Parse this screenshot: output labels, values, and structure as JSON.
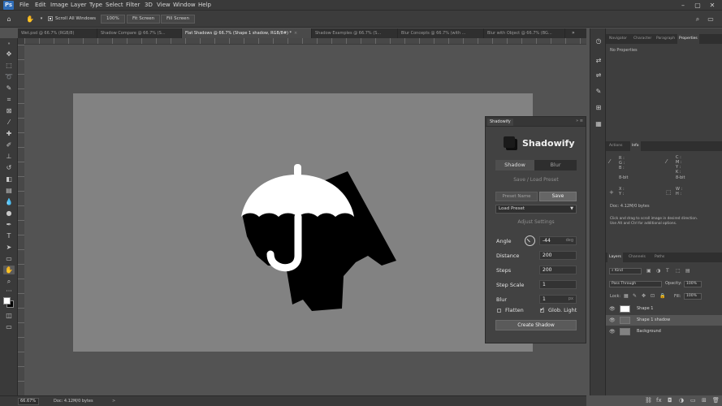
{
  "app": {
    "logo": "Ps"
  },
  "menu": [
    "File",
    "Edit",
    "Image",
    "Layer",
    "Type",
    "Select",
    "Filter",
    "3D",
    "View",
    "Window",
    "Help"
  ],
  "options_bar": {
    "scroll_all": "Scroll All Windows",
    "zoom_100": "100%",
    "fit_screen": "Fit Screen",
    "fill_screen": "Fill Screen"
  },
  "tabs": [
    {
      "label": "Wet.psd @ 66.7% (RGB/8)",
      "active": false
    },
    {
      "label": "Shadow Compare @ 66.7% (S...",
      "active": false
    },
    {
      "label": "Flat Shadows @ 66.7% (Shape 1 shadow, RGB/8#) *",
      "active": true
    },
    {
      "label": "Shadow Examples @ 66.7% (S...",
      "active": false
    },
    {
      "label": "Blur Concepts @ 66.7% (with ...",
      "active": false
    },
    {
      "label": "Blur with Object @ 66.7% (BG...",
      "active": false
    }
  ],
  "shadowify": {
    "panel_tab": "Shadowify",
    "panel_ctrls": "»  ≡",
    "title": "Shadowify",
    "tab_shadow": "Shadow",
    "tab_blur": "Blur",
    "save_load_header": "Save / Load Preset",
    "preset_name_placeholder": "Preset Name",
    "save_label": "Save",
    "load_preset": "Load Preset",
    "adjust_header": "Adjust Settings",
    "angle_label": "Angle",
    "angle_value": "-44",
    "angle_unit": "deg",
    "distance_label": "Distance",
    "distance_value": "200",
    "steps_label": "Steps",
    "steps_value": "200",
    "step_scale_label": "Step Scale",
    "step_scale_value": "1",
    "blur_label": "Blur",
    "blur_value": "1",
    "blur_unit": "px",
    "flatten_label": "Flatten",
    "flatten_checked": false,
    "global_light_label": "Glob. Light",
    "global_light_checked": true,
    "create_label": "Create Shadow"
  },
  "properties_panel": {
    "tabs": [
      "Navigator",
      "Character",
      "Paragraph",
      "Properties"
    ],
    "active_tab": "Properties",
    "content": "No Properties"
  },
  "info_panel": {
    "tabs": [
      "Actions",
      "Info"
    ],
    "active_tab": "Info",
    "r": "R :",
    "g": "G :",
    "b": "B :",
    "bit_left": "8-bit",
    "c": "C :",
    "m": "M :",
    "y": "Y :",
    "k": "K :",
    "bit_right": "8-bit",
    "x": "X :",
    "y_coord": "Y :",
    "w": "W :",
    "h": "H :",
    "doc": "Doc: 4.12M/0 bytes",
    "hint1": "Click and drag to scroll image in desired direction.",
    "hint2": "Use Alt and Ctrl for additional options."
  },
  "layers_panel": {
    "tabs": [
      "Layers",
      "Channels",
      "Paths"
    ],
    "active_tab": "Layers",
    "kind": "Kind",
    "blend_mode": "Pass Through",
    "opacity_label": "Opacity:",
    "opacity_value": "100%",
    "lock_label": "Lock:",
    "fill_label": "Fill:",
    "fill_value": "100%",
    "layers": [
      {
        "name": "Shape 1",
        "selected": false,
        "visible": true
      },
      {
        "name": "Shape 1 shadow",
        "selected": true,
        "visible": true
      },
      {
        "name": "Background",
        "selected": false,
        "visible": true
      }
    ]
  },
  "status": {
    "zoom": "66.67%",
    "doc": "Doc: 4.12M/0 bytes",
    "arrow": ">"
  },
  "colors": {
    "accent": "#2f6db8",
    "canvas": "#828282",
    "ui_dark": "#3a3a3a"
  },
  "icons": {
    "home": "home-icon",
    "hand": "hand-icon",
    "move": "move-icon",
    "marquee": "marquee-icon",
    "lasso": "lasso-icon",
    "crop": "crop-icon",
    "brush": "brush-icon",
    "eye": "eye-icon"
  }
}
